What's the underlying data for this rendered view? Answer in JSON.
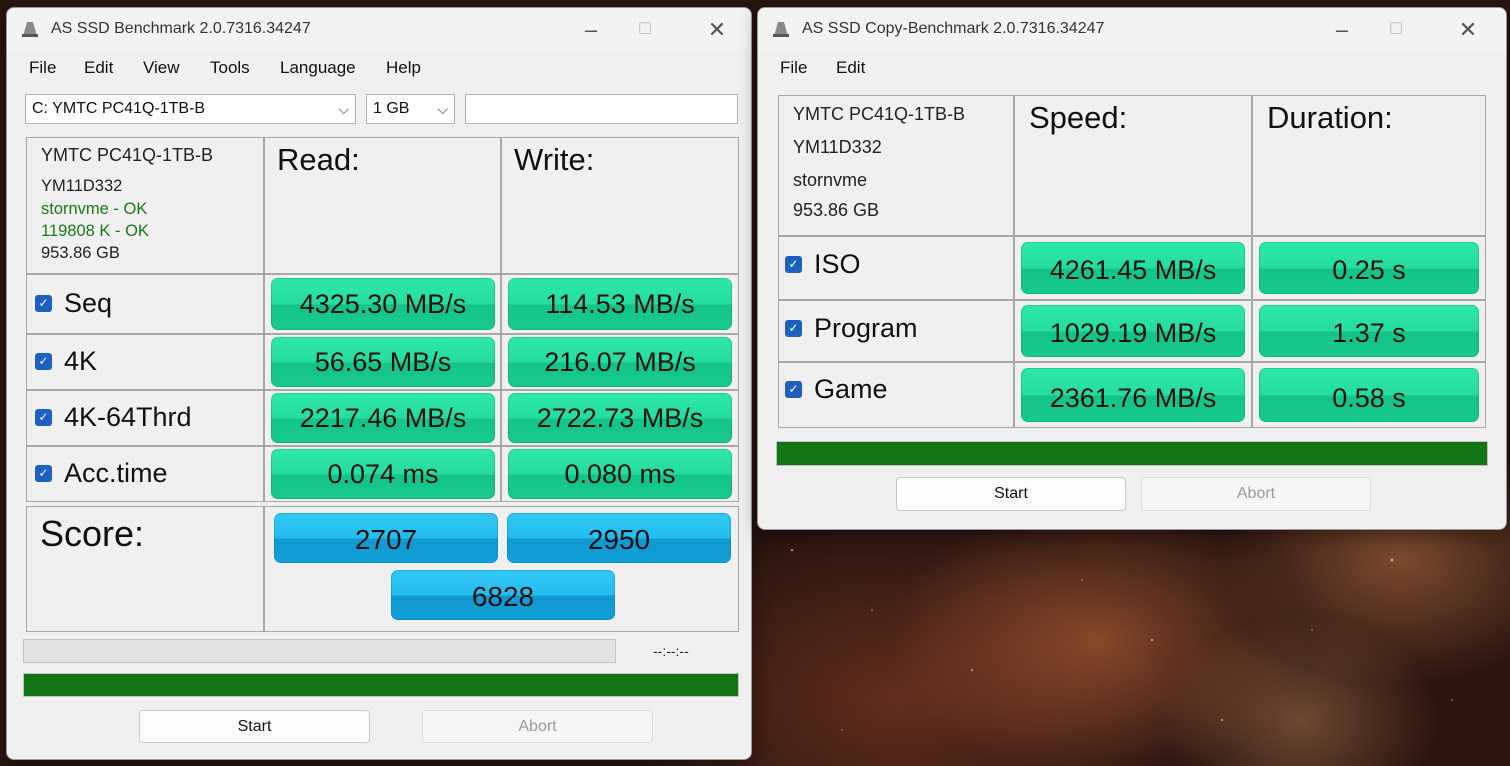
{
  "benchmark": {
    "title": "AS SSD Benchmark 2.0.7316.34247",
    "menu": [
      "File",
      "Edit",
      "View",
      "Tools",
      "Language",
      "Help"
    ],
    "drive_select": "C: YMTC PC41Q-1TB-B",
    "size_select": "1 GB",
    "info": {
      "model": "YMTC PC41Q-1TB-B",
      "firmware": "YM11D332",
      "driver": "stornvme - OK",
      "alignment": "119808 K - OK",
      "capacity": "953.86 GB"
    },
    "headers": {
      "read": "Read:",
      "write": "Write:"
    },
    "rows": [
      {
        "label": "Seq",
        "read": "4325.30 MB/s",
        "write": "114.53 MB/s"
      },
      {
        "label": "4K",
        "read": "56.65 MB/s",
        "write": "216.07 MB/s"
      },
      {
        "label": "4K-64Thrd",
        "read": "2217.46 MB/s",
        "write": "2722.73 MB/s"
      },
      {
        "label": "Acc.time",
        "read": "0.074 ms",
        "write": "0.080 ms"
      }
    ],
    "score": {
      "label": "Score:",
      "read": "2707",
      "write": "2950",
      "total": "6828"
    },
    "time_left": "--:--:--",
    "progress_fraction": 1.0,
    "start_label": "Start",
    "abort_label": "Abort"
  },
  "copy": {
    "title": "AS SSD Copy-Benchmark 2.0.7316.34247",
    "menu": [
      "File",
      "Edit"
    ],
    "info": {
      "model": "YMTC PC41Q-1TB-B",
      "firmware": "YM11D332",
      "driver": "stornvme",
      "capacity": "953.86 GB"
    },
    "headers": {
      "speed": "Speed:",
      "duration": "Duration:"
    },
    "rows": [
      {
        "label": "ISO",
        "speed": "4261.45 MB/s",
        "duration": "0.25 s"
      },
      {
        "label": "Program",
        "speed": "1029.19 MB/s",
        "duration": "1.37 s"
      },
      {
        "label": "Game",
        "speed": "2361.76 MB/s",
        "duration": "0.58 s"
      }
    ],
    "progress_fraction": 1.0,
    "start_label": "Start",
    "abort_label": "Abort"
  },
  "colors": {
    "result_green": "#26dca0",
    "score_blue": "#24bdef",
    "progress_green": "#127412",
    "checkbox_blue": "#1f5fbf",
    "ok_green": "#1a7a1a"
  },
  "icons": [
    "disk-icon",
    "minimize-icon",
    "maximize-icon",
    "close-icon",
    "chevron-down-icon",
    "checkbox-checked-icon"
  ]
}
